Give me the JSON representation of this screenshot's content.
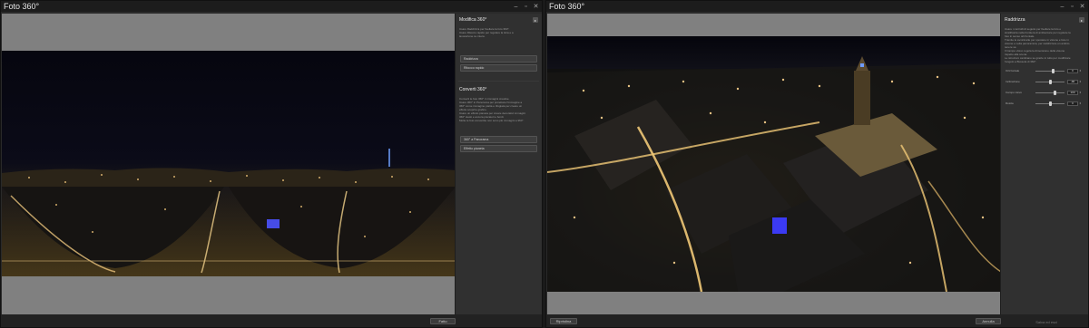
{
  "left_window": {
    "title": "Foto 360°",
    "footer_button": "Fatto",
    "panel": {
      "section1_title": "Modifica 360°",
      "section1_text_lines": [
        "Usare Raddrizza per livellare la foto 360°.",
        "Usare Ritocco rapido per regolare la tinta e a",
        "lavorazione su intera."
      ],
      "section1_buttons": [
        "Raddrizza",
        "Ritocco rapido"
      ],
      "section2_title": "Converti 360°",
      "section2_text_lines": [
        "Converti le foto 360° in immagini creative.",
        "",
        "Usare 360° in Panorama per proiettare l'immagine a",
        "360° come immagine piatta e rifugiata per creare un",
        "effetto scoprire grafico.",
        "",
        "Usare un effetto pianeta per creare decorativi immagini",
        "360° stesti e ancora piscatori e bordi.",
        "",
        "Molte le foto convertite non sono più immagini a 360°."
      ],
      "section2_buttons": [
        "360° a Panorama",
        "Effetto pianeta"
      ]
    }
  },
  "right_window": {
    "title": "Foto 360°",
    "footer_left_button": "Ripristina",
    "footer_right_text": "Salva ed esci",
    "footer_right_button": "Annulla",
    "panel": {
      "title": "Raddrizza",
      "text_lines": [
        "Usare i controlli di seguito per livellare la foto e",
        "stratificarla nella frontiera di ambientare per regolare la",
        "foto in senso orizzontale.",
        "",
        "Tramite le avvicinarle per spostare in visione e fare in",
        "visione e nella panoramica, per raddrizzare un ambito",
        "tenere sé.",
        "",
        "Il Campo visivo regola la dimensione della visione",
        "rispetto alla scena.",
        "Le istruzioni cambiano se grazie in tutto per modificare",
        "l'angolo a Bussola di 360°."
      ],
      "sliders": [
        {
          "label": "Orizzontale",
          "value": "0",
          "level": 0.62
        },
        {
          "label": "Inclinazione",
          "value": "-90",
          "level": 0.5
        },
        {
          "label": "Campo visivo",
          "value": "100",
          "level": 0.66
        },
        {
          "label": "Rotola",
          "value": "0",
          "level": 0.5
        }
      ]
    }
  },
  "window_controls": [
    "–",
    "▫",
    "✕"
  ],
  "colors": {
    "window_bg": "#2a2a2a",
    "workarea_bg": "#808080",
    "panel_bg": "#303030",
    "accent": "#f0f0f0"
  }
}
